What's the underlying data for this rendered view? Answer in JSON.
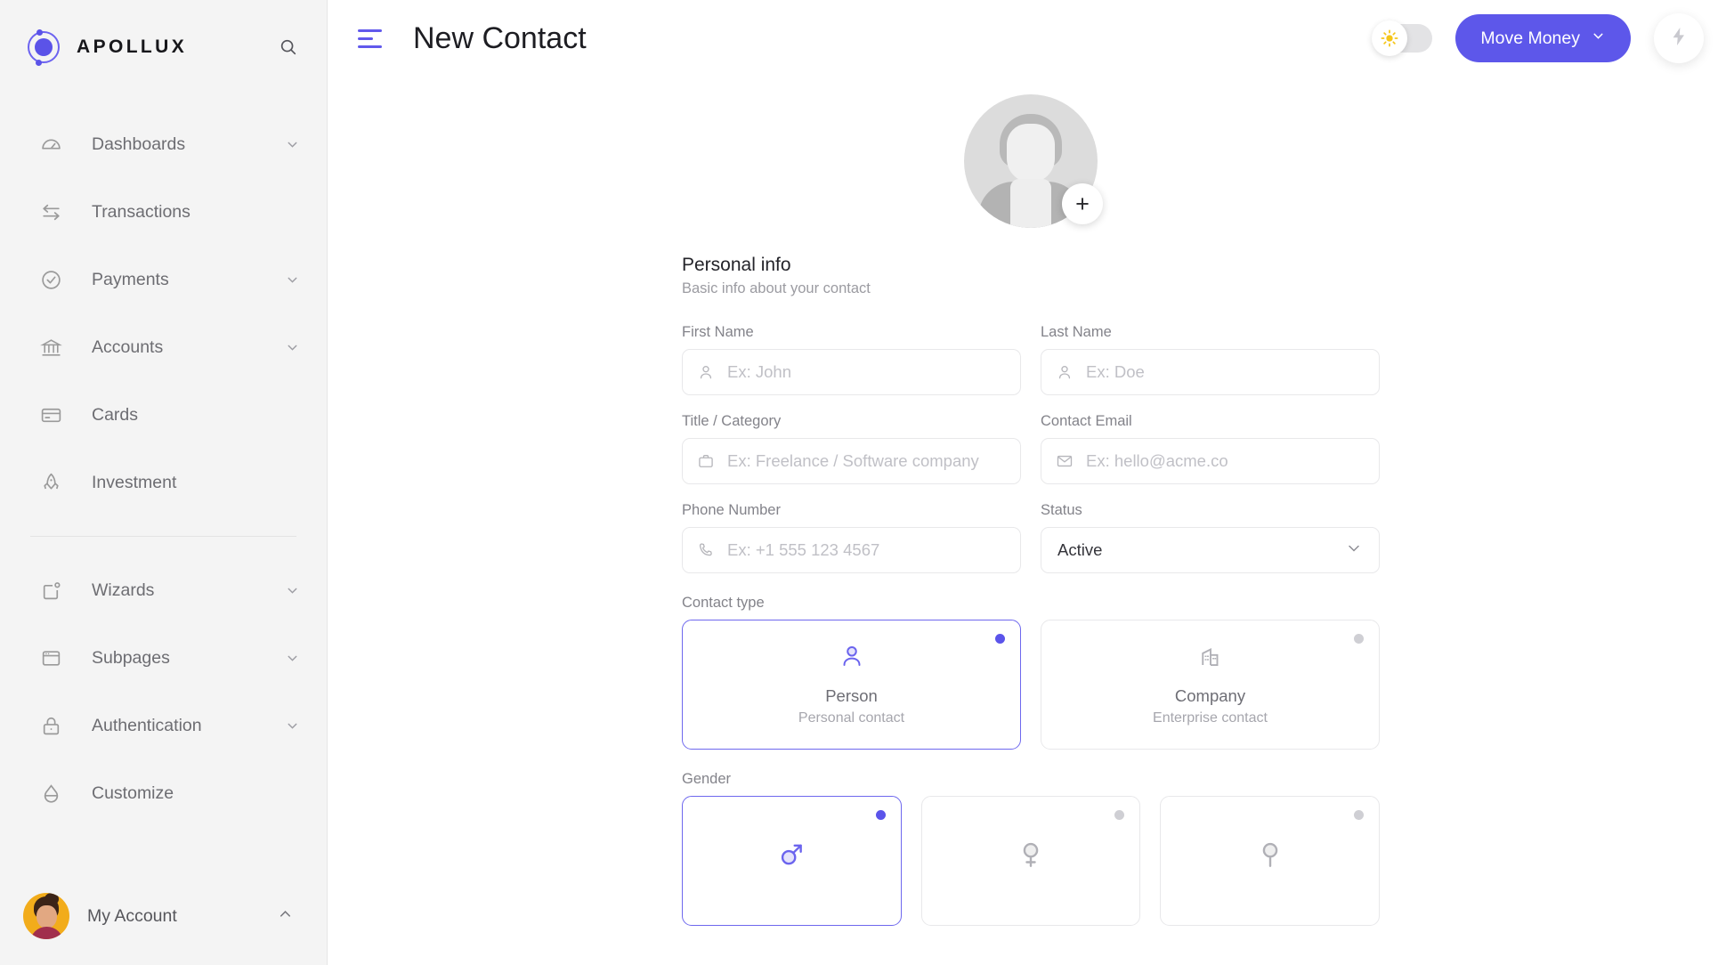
{
  "brand": {
    "name": "APOLLUX",
    "search_icon": "search-icon"
  },
  "sidebar": {
    "items": [
      {
        "label": "Dashboards",
        "icon": "gauge-icon",
        "chevron": true
      },
      {
        "label": "Transactions",
        "icon": "transfer-icon",
        "chevron": false
      },
      {
        "label": "Payments",
        "icon": "check-circle-icon",
        "chevron": true
      },
      {
        "label": "Accounts",
        "icon": "bank-icon",
        "chevron": true
      },
      {
        "label": "Cards",
        "icon": "credit-card-icon",
        "chevron": false
      },
      {
        "label": "Investment",
        "icon": "rocket-icon",
        "chevron": false
      },
      {
        "label": "Wizards",
        "icon": "wizard-icon",
        "chevron": true
      },
      {
        "label": "Subpages",
        "icon": "window-icon",
        "chevron": true
      },
      {
        "label": "Authentication",
        "icon": "lock-icon",
        "chevron": true
      },
      {
        "label": "Customize",
        "icon": "droplet-icon",
        "chevron": false
      }
    ],
    "divider_after_index": 5,
    "account": {
      "label": "My Account",
      "chevron": "chevron-up-icon"
    }
  },
  "topbar": {
    "menu_icon": "hamburger-icon",
    "title": "New Contact",
    "theme_toggle": {
      "state": "light",
      "icon": "sun-icon"
    },
    "move_money_label": "Move Money",
    "move_money_chevron": "chevron-down-icon",
    "quick_action_icon": "lightning-bolt-icon"
  },
  "form": {
    "avatar": {
      "upload_label": "+",
      "placeholder_icon": "user-placeholder-avatar"
    },
    "section": {
      "title": "Personal info",
      "subtitle": "Basic info about your contact"
    },
    "fields": [
      {
        "label": "First Name",
        "placeholder": "Ex: John",
        "value": "",
        "icon": "person-icon"
      },
      {
        "label": "Last Name",
        "placeholder": "Ex: Doe",
        "value": "",
        "icon": "person-icon"
      },
      {
        "label": "Title / Category",
        "placeholder": "Ex: Freelance / Software company",
        "value": "",
        "icon": "briefcase-icon"
      },
      {
        "label": "Contact Email",
        "placeholder": "Ex: hello@acme.co",
        "value": "",
        "icon": "envelope-icon"
      },
      {
        "label": "Phone Number",
        "placeholder": "Ex: +1 555 123 4567",
        "value": "",
        "icon": "phone-icon"
      }
    ],
    "status": {
      "label": "Status",
      "value": "Active",
      "chevron": "chevron-down-icon"
    },
    "contact_type": {
      "label": "Contact type",
      "options": [
        {
          "name": "Person",
          "desc": "Personal contact",
          "icon": "person-icon",
          "selected": true
        },
        {
          "name": "Company",
          "desc": "Enterprise contact",
          "icon": "building-icon",
          "selected": false
        }
      ]
    },
    "gender": {
      "label": "Gender",
      "options": [
        {
          "icon": "male-symbol-icon",
          "selected": true
        },
        {
          "icon": "female-symbol-icon",
          "selected": false
        },
        {
          "icon": "neutral-symbol-icon",
          "selected": false
        }
      ]
    }
  },
  "colors": {
    "accent": "#5d57ea",
    "sidebar_bg": "#f4f4f4",
    "main_bg": "#ffffff",
    "avatar_bg": "#f2ac1b"
  }
}
